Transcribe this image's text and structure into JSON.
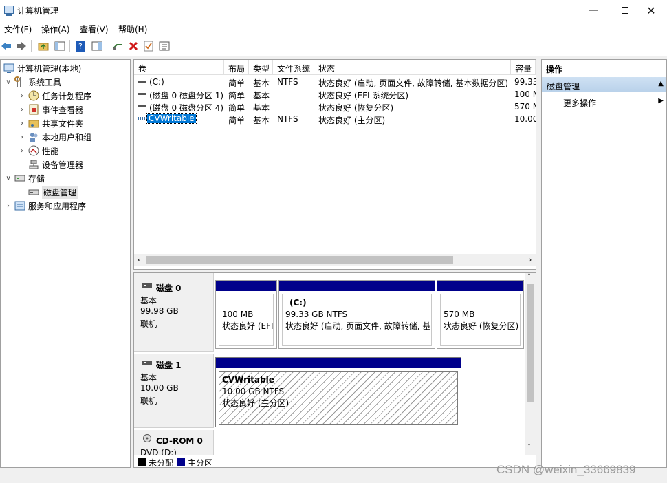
{
  "window": {
    "title": "计算机管理"
  },
  "menu": [
    "文件(F)",
    "操作(A)",
    "查看(V)",
    "帮助(H)"
  ],
  "tree": {
    "root": "计算机管理(本地)",
    "system_tools": "系统工具",
    "task_scheduler": "任务计划程序",
    "event_viewer": "事件查看器",
    "shared_folders": "共享文件夹",
    "local_users": "本地用户和组",
    "performance": "性能",
    "device_manager": "设备管理器",
    "storage": "存储",
    "disk_management": "磁盘管理",
    "services_apps": "服务和应用程序"
  },
  "volumes": {
    "headers": [
      "卷",
      "布局",
      "类型",
      "文件系统",
      "状态",
      "容量"
    ],
    "rows": [
      {
        "name": "(C:)",
        "layout": "简单",
        "type": "基本",
        "fs": "NTFS",
        "status": "状态良好 (启动, 页面文件, 故障转储, 基本数据分区)",
        "capacity": "99.33"
      },
      {
        "name": "(磁盘 0 磁盘分区 1)",
        "layout": "简单",
        "type": "基本",
        "fs": "",
        "status": "状态良好 (EFI 系统分区)",
        "capacity": "100 M"
      },
      {
        "name": "(磁盘 0 磁盘分区 4)",
        "layout": "简单",
        "type": "基本",
        "fs": "",
        "status": "状态良好 (恢复分区)",
        "capacity": "570 M"
      },
      {
        "name": "CVWritable",
        "layout": "简单",
        "type": "基本",
        "fs": "NTFS",
        "status": "状态良好 (主分区)",
        "capacity": "10.00"
      }
    ]
  },
  "disks": [
    {
      "name": "磁盘 0",
      "kind": "基本",
      "size": "99.98 GB",
      "state": "联机",
      "partitions": [
        {
          "title": "",
          "size": "100 MB",
          "status": "状态良好 (EFI"
        },
        {
          "title": "(C:)",
          "size": "99.33 GB NTFS",
          "status": "状态良好 (启动, 页面文件, 故障转储, 基本"
        },
        {
          "title": "",
          "size": "570 MB",
          "status": "状态良好 (恢复分区)"
        }
      ]
    },
    {
      "name": "磁盘 1",
      "kind": "基本",
      "size": "10.00 GB",
      "state": "联机",
      "partitions": [
        {
          "title": "CVWritable",
          "size": "10.00 GB NTFS",
          "status": "状态良好 (主分区)"
        }
      ]
    },
    {
      "name": "CD-ROM 0",
      "kind": "DVD (D:)"
    }
  ],
  "legend": {
    "unallocated": "未分配",
    "primary": "主分区",
    "colors": {
      "unallocated": "#000000",
      "primary": "#00008b"
    }
  },
  "actions": {
    "header": "操作",
    "section": "磁盘管理",
    "more": "更多操作"
  },
  "watermark": "CSDN @weixin_33669839"
}
